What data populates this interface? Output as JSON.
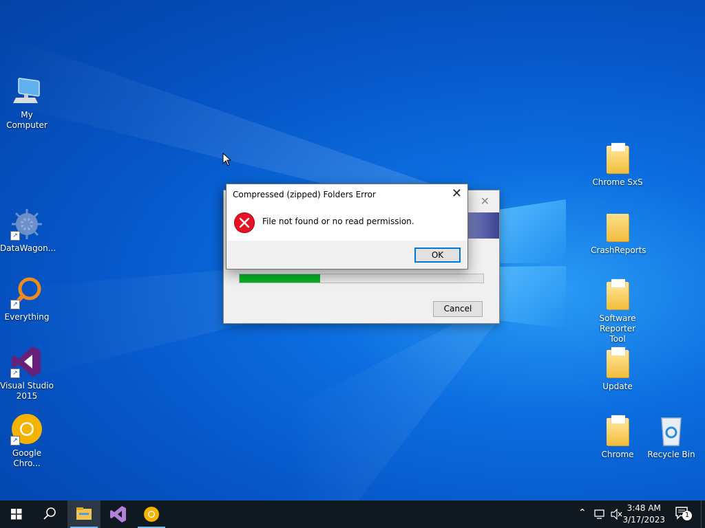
{
  "desktop": {
    "icons_left": [
      {
        "label": "My Computer",
        "icon": "computer-icon"
      },
      {
        "label": "DataWagon...",
        "icon": "datawagon-icon"
      },
      {
        "label": "Everything",
        "icon": "everything-search-icon"
      },
      {
        "label": "Visual Studio 2015",
        "icon": "visual-studio-icon"
      },
      {
        "label": "Google Chro...",
        "icon": "chrome-canary-icon"
      }
    ],
    "icons_right": [
      {
        "label": "Chrome SxS",
        "icon": "folder-icon"
      },
      {
        "label": "CrashReports",
        "icon": "folder-icon"
      },
      {
        "label": "Software Reporter Tool",
        "icon": "folder-icon"
      },
      {
        "label": "Update",
        "icon": "folder-icon"
      },
      {
        "label": "Chrome",
        "icon": "folder-icon"
      },
      {
        "label": "Recycle Bin",
        "icon": "recycle-bin-icon"
      }
    ]
  },
  "background_window": {
    "cancel_label": "Cancel",
    "progress": 0.33,
    "progress_color": "#06b025"
  },
  "error_dialog": {
    "title": "Compressed (zipped) Folders Error",
    "message": "File not found or no read permission.",
    "ok_label": "OK",
    "icon": "error-icon",
    "accent": "#0078d7"
  },
  "taskbar": {
    "time": "3:48 AM",
    "date": "3/17/2023",
    "notification_count": "1",
    "apps": [
      "file-explorer-icon",
      "visual-studio-icon",
      "chrome-canary-icon"
    ]
  }
}
